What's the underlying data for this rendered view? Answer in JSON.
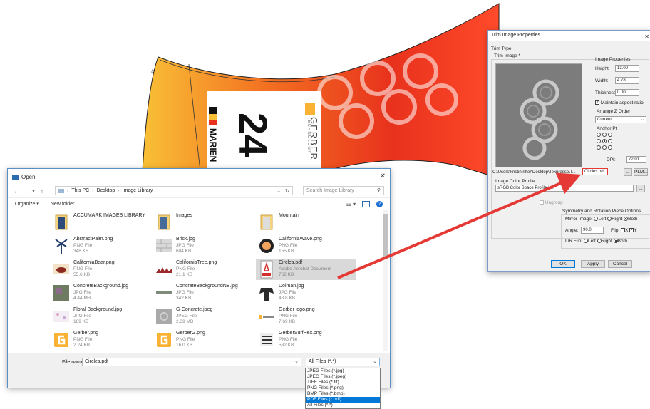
{
  "artwork": {
    "banner_small_text": "MARIEN",
    "banner_big_text": "24",
    "logo_text": "GERBER",
    "logo_sub": "TECHNOLOGY",
    "colors": {
      "orange": "#f37021",
      "red": "#e8321d",
      "yellow": "#f9b233",
      "annotation_arrow": "#e53935"
    }
  },
  "open_dialog": {
    "title": "Open",
    "breadcrumb": [
      "This PC",
      "Desktop",
      "Image Library"
    ],
    "search_placeholder": "Search Image Library",
    "toolbar": {
      "organize": "Organize ▾",
      "new_folder": "New folder"
    },
    "files": [
      {
        "name": "ACCUMARK IMAGES LIBRARY",
        "type": "",
        "size": "",
        "icon": "folder-icon"
      },
      {
        "name": "Images",
        "type": "",
        "size": "",
        "icon": "folder-icon"
      },
      {
        "name": "Mountain",
        "type": "",
        "size": "",
        "icon": "folder-icon"
      },
      {
        "name": "AbstractPalm.png",
        "type": "PNG File",
        "size": "348 KB",
        "icon": "palm-thumbnail"
      },
      {
        "name": "Brick.jpg",
        "type": "JPG File",
        "size": "604 KB",
        "icon": "brick-thumbnail"
      },
      {
        "name": "CaliforniaWave.png",
        "type": "PNG File",
        "size": "155 KB",
        "icon": "wave-thumbnail"
      },
      {
        "name": "CaliforniaBear.png",
        "type": "PNG File",
        "size": "55.6 KB",
        "icon": "bear-thumbnail"
      },
      {
        "name": "CaliforniaTree.png",
        "type": "PNG File",
        "size": "21.1 KB",
        "icon": "tree-thumbnail"
      },
      {
        "name": "Circles.pdf",
        "type": "Adobe Acrobat Document",
        "size": "762 KB",
        "icon": "pdf-icon",
        "selected": true
      },
      {
        "name": "ConcreteBackground.jpg",
        "type": "JPG File",
        "size": "4.44 MB",
        "icon": "concrete-thumbnail"
      },
      {
        "name": "ConcreteBackgroundNB.jpg",
        "type": "JPG File",
        "size": "342 KB",
        "icon": "concrete-strip-thumbnail"
      },
      {
        "name": "Dolman.jpg",
        "type": "JPG File",
        "size": "48.8 KB",
        "icon": "dolman-thumbnail"
      },
      {
        "name": "Floral Background.jpg",
        "type": "JPG File",
        "size": "189 KB",
        "icon": "floral-thumbnail"
      },
      {
        "name": "G-Concrete.jpeg",
        "type": "JPEG File",
        "size": "2.39 MB",
        "icon": "gconcrete-thumbnail"
      },
      {
        "name": "Gerber logo.png",
        "type": "PNG File",
        "size": "7.69 KB",
        "icon": "gerber-logo-thumbnail"
      },
      {
        "name": "Gerber.png",
        "type": "PNG File",
        "size": "2.24 KB",
        "icon": "gerber-g-thumbnail"
      },
      {
        "name": "GerberG.png",
        "type": "PNG File",
        "size": "16.0 KB",
        "icon": "gerber-g-thumbnail"
      },
      {
        "name": "GerberSurfHex.png",
        "type": "PNG File",
        "size": "582 KB",
        "icon": "surfhex-thumbnail"
      }
    ],
    "filename_label": "File name:",
    "filename_value": "Circles.pdf",
    "filetype_value": "All Files (*.*)",
    "filetype_options": [
      "JPEG Files (*.jpg)",
      "JPEG Files (*.jpeg)",
      "TIFF Files (*.tif)",
      "PNG Files (*.png)",
      "BMP Files (*.bmp)",
      "PDF Files (*.pdf)",
      "All Files (*.*)"
    ],
    "filetype_selected_option": "PDF Files (*.pdf)"
  },
  "trim_dialog": {
    "title": "Trim Image Properties",
    "trim_type_label": "Trim Type",
    "trim_image_label": "Trim Image *",
    "image_properties_label": "Image Properties",
    "height_label": "Height:",
    "height_value": "13.00",
    "width_label": "Width:",
    "width_value": "4.78",
    "thickness_label": "Thickness:",
    "thickness_value": "0.00",
    "maintain_aspect_label": "Maintain aspect ratio",
    "arrange_z_label": "Arrange Z Order",
    "arrange_z_value": "Current",
    "anchor_pt_label": "Anchor Pt",
    "dpi_label": "DPI:",
    "dpi_value": "72.01",
    "path_value": "C:\\Users\\kristin.ritter\\Desktop\\Texpresso\\T...",
    "path_file": "Circles.pdf",
    "browse_label": "...",
    "plm_label": "PLM...",
    "color_profile_label": "Image Color Profile",
    "color_profile_value": "sRGB Color Space Profile.icm",
    "color_profile_browse": "...",
    "ungroup_label": "Ungroup",
    "symmetry_label": "Symmetry and Rotation Piece Options",
    "mirror_label": "Mirror Image:",
    "left_label": "Left",
    "right_label": "Right",
    "both_label": "Both",
    "angle_label": "Angle:",
    "angle_value": "90.0",
    "flip_label": "Flip:",
    "flip_x": "X",
    "flip_y": "Y",
    "lr_flip_label": "L/R Flip:",
    "ok_label": "OK",
    "apply_label": "Apply",
    "cancel_label": "Cancel"
  }
}
